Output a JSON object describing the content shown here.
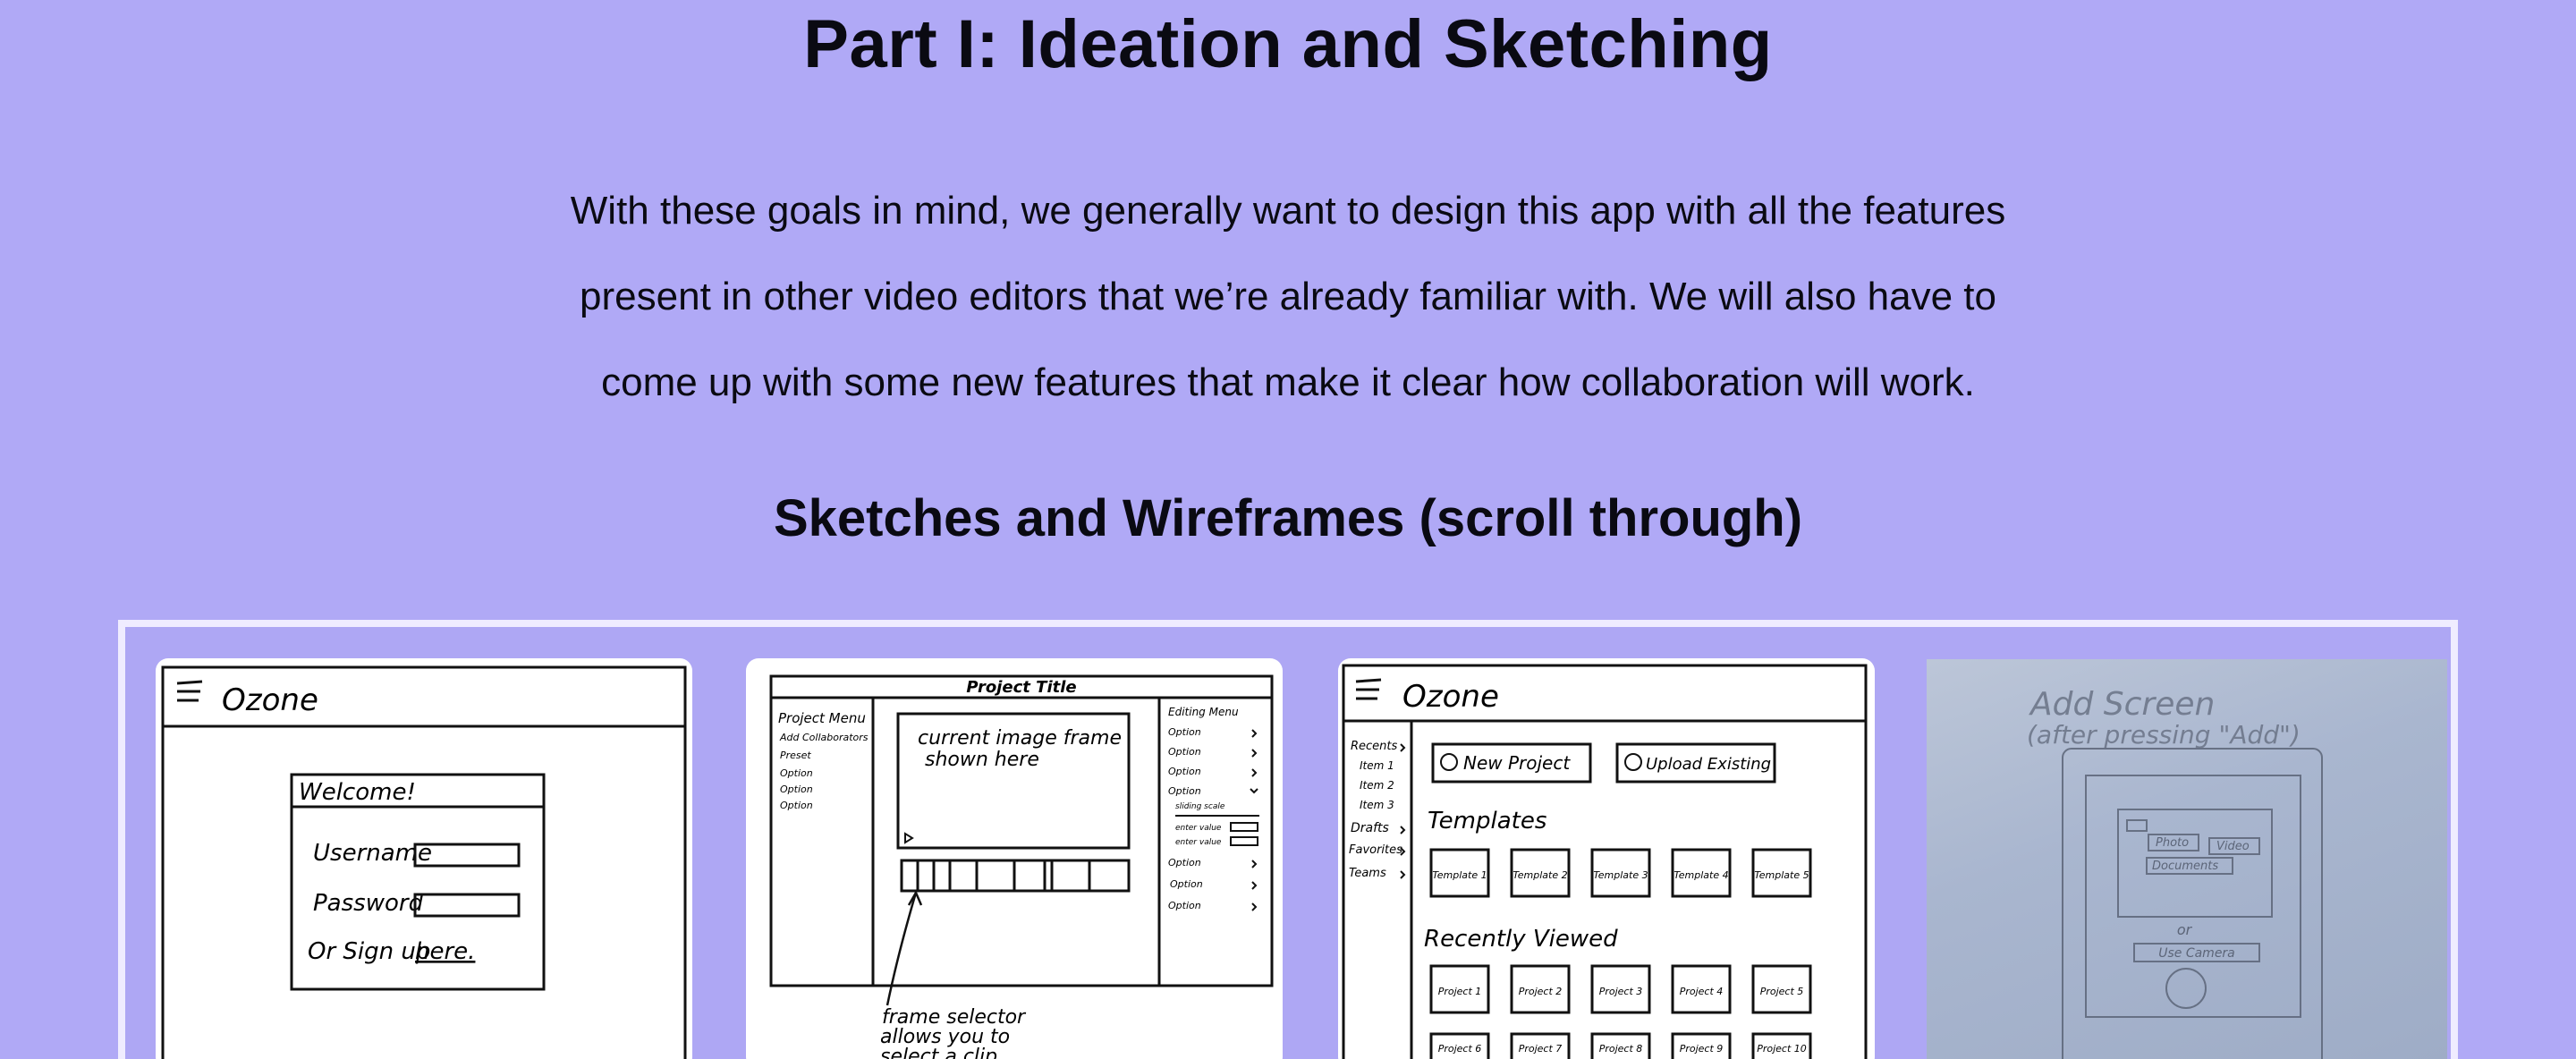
{
  "page": {
    "title": "Part I: Ideation and Sketching",
    "intro": "With these goals in mind, we generally want to design this app with all the features present in other video editors that we’re already familiar with. We will also have to come up with some new features that make it clear how collaboration will work.",
    "subtitle": "Sketches and Wireframes (scroll through)"
  },
  "sketch1": {
    "app_name": "Ozone",
    "welcome": "Welcome!",
    "username_label": "Username",
    "password_label": "Password",
    "signup_prefix": "Or Sign up",
    "signup_link": "here."
  },
  "sketch2": {
    "project_title": "Project Title",
    "menu_title": "Project Menu",
    "menu_items": [
      "Add Collaborators",
      "Preset",
      "Option",
      "Option",
      "Option"
    ],
    "frame_caption_1": "current image frame",
    "frame_caption_2": "shown here",
    "editing_title": "Editing Menu",
    "editing_options": [
      "Option",
      "Option",
      "Option",
      "Option"
    ],
    "sliding_scale": "sliding scale",
    "enter_value_1": "enter value",
    "enter_value_2": "enter value",
    "editing_options_lower": [
      "Option",
      "Option",
      "Option"
    ],
    "note_1": "frame selector",
    "note_2": "allows you to",
    "note_3": "select a clip"
  },
  "sketch3": {
    "app_name": "Ozone",
    "side_items": [
      "Recents",
      "Item 1",
      "Item 2",
      "Item 3",
      "Drafts",
      "Favorites",
      "Teams"
    ],
    "new_project": "New Project",
    "upload_existing": "Upload Existing",
    "templates_heading": "Templates",
    "templates": [
      "Template 1",
      "Template 2",
      "Template 3",
      "Template 4",
      "Template 5"
    ],
    "recent_heading": "Recently Viewed",
    "projects_row1": [
      "Project 1",
      "Project 2",
      "Project 3",
      "Project 4",
      "Project 5"
    ],
    "projects_row2": [
      "Project 6",
      "Project 7",
      "Project 8",
      "Project 9",
      "Project 10"
    ]
  },
  "sketch4": {
    "heading_1": "Add Screen",
    "heading_2": "(after pressing \"Add\")",
    "btn_photo": "Photo",
    "btn_video": "Video",
    "btn_documents": "Documents",
    "or_text": "or",
    "use_camera": "Use Camera"
  }
}
